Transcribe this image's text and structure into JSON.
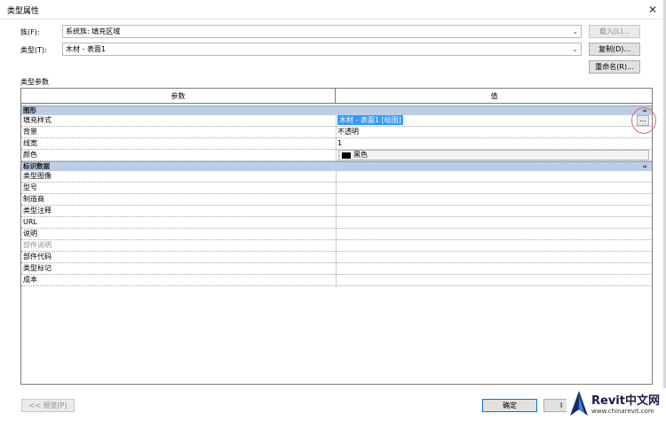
{
  "window": {
    "title": "类型属性",
    "close_glyph": "✕"
  },
  "family": {
    "label": "族(F):",
    "value": "系统族: 填充区域",
    "load_button": "载入(L)..."
  },
  "type": {
    "label": "类型(T):",
    "value": "木材 - 表面1",
    "duplicate_button": "复制(D)...",
    "rename_button": "重命名(R)..."
  },
  "type_params_label": "类型参数",
  "grid": {
    "header": {
      "param": "参数",
      "value": "值"
    },
    "groups": [
      {
        "name": "图形",
        "collapse_glyph": "≈",
        "rows": [
          {
            "param": "填充样式",
            "value": "木材 - 表面1 [绘图]",
            "dim": false
          },
          {
            "param": "背景",
            "value": "不透明",
            "dim": false
          },
          {
            "param": "线宽",
            "value": "1",
            "dim": false
          },
          {
            "param": "颜色",
            "value": "黑色",
            "dim": false
          }
        ]
      },
      {
        "name": "标识数据",
        "collapse_glyph": "≈",
        "rows": [
          {
            "param": "类型图像",
            "value": "",
            "dim": false
          },
          {
            "param": "型号",
            "value": "",
            "dim": false
          },
          {
            "param": "制造商",
            "value": "",
            "dim": false
          },
          {
            "param": "类型注释",
            "value": "",
            "dim": false
          },
          {
            "param": "URL",
            "value": "",
            "dim": false
          },
          {
            "param": "说明",
            "value": "",
            "dim": false
          },
          {
            "param": "部件说明",
            "value": "",
            "dim": true
          },
          {
            "param": "部件代码",
            "value": "",
            "dim": false
          },
          {
            "param": "类型标记",
            "value": "",
            "dim": false
          },
          {
            "param": "成本",
            "value": "",
            "dim": false
          }
        ]
      }
    ],
    "browse_button": "..."
  },
  "footer": {
    "preview_button": "<< 预览(P)",
    "ok_button": "确定",
    "cancel_fragment": "I"
  },
  "watermark": {
    "brand": "Revit中文网",
    "url": "www.chinarevit.com"
  },
  "colors": {
    "group_header": "#bccde6",
    "selection": "#3399ff",
    "annotation_circle": "#e06c6c"
  }
}
